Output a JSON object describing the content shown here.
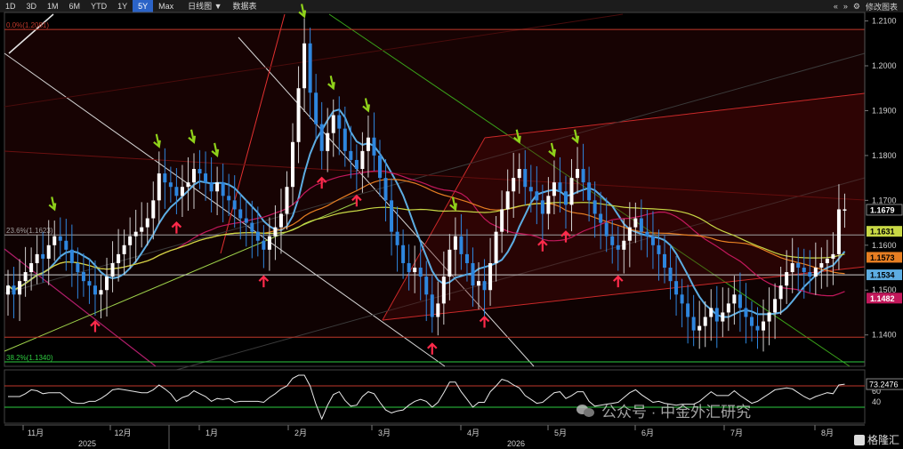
{
  "toolbar": {
    "ranges": [
      "1D",
      "3D",
      "1M",
      "6M",
      "YTD",
      "1Y",
      "5Y",
      "Max"
    ],
    "active_range": "5Y",
    "chart_type": "日线图 ▼",
    "data_table": "数据表",
    "edit_chart": "修改图表",
    "nav_prev": "«",
    "nav_next": "»",
    "settings_glyph": "⚙"
  },
  "watermark": "公众号 · 中金外汇研究",
  "brand": "格隆汇",
  "chart_data": {
    "type": "candlestick",
    "x_axis": {
      "month_labels": [
        "11月",
        "12月",
        "1月",
        "2月",
        "3月",
        "4月",
        "5月",
        "6月",
        "7月",
        "8月"
      ],
      "year_labels": [
        "2025",
        "2026"
      ]
    },
    "y_axis": {
      "ylim": [
        1.133,
        1.2115
      ],
      "ticks": [
        "1.2100",
        "1.2000",
        "1.1900",
        "1.1800",
        "1.1700",
        "1.1600",
        "1.1500",
        "1.1400"
      ]
    },
    "price_close": [
      1.151,
      1.149,
      1.152,
      1.154,
      1.156,
      1.158,
      1.157,
      1.16,
      1.162,
      1.161,
      1.159,
      1.156,
      1.154,
      1.152,
      1.151,
      1.149,
      1.15,
      1.153,
      1.156,
      1.158,
      1.16,
      1.162,
      1.163,
      1.164,
      1.166,
      1.17,
      1.176,
      1.174,
      1.173,
      1.171,
      1.173,
      1.174,
      1.177,
      1.176,
      1.174,
      1.172,
      1.174,
      1.171,
      1.17,
      1.168,
      1.166,
      1.165,
      1.163,
      1.161,
      1.159,
      1.162,
      1.164,
      1.167,
      1.173,
      1.183,
      1.195,
      1.205,
      1.194,
      1.187,
      1.181,
      1.185,
      1.189,
      1.186,
      1.181,
      1.179,
      1.177,
      1.181,
      1.184,
      1.18,
      1.175,
      1.17,
      1.163,
      1.16,
      1.156,
      1.154,
      1.155,
      1.153,
      1.149,
      1.144,
      1.147,
      1.153,
      1.159,
      1.162,
      1.158,
      1.156,
      1.151,
      1.152,
      1.15,
      1.156,
      1.163,
      1.168,
      1.172,
      1.175,
      1.177,
      1.173,
      1.172,
      1.17,
      1.167,
      1.171,
      1.174,
      1.172,
      1.169,
      1.175,
      1.177,
      1.174,
      1.17,
      1.167,
      1.165,
      1.162,
      1.16,
      1.159,
      1.161,
      1.164,
      1.166,
      1.163,
      1.162,
      1.16,
      1.158,
      1.155,
      1.152,
      1.149,
      1.147,
      1.144,
      1.141,
      1.142,
      1.144,
      1.146,
      1.143,
      1.145,
      1.147,
      1.149,
      1.146,
      1.144,
      1.142,
      1.141,
      1.143,
      1.145,
      1.148,
      1.151,
      1.154,
      1.156,
      1.155,
      1.154,
      1.153,
      1.155,
      1.156,
      1.157,
      1.158,
      1.168,
      1.168
    ],
    "overlay_lines": [
      {
        "label": "0.0%(1.2081)",
        "value": 1.2081,
        "color": "#c0392b"
      },
      {
        "label": "23.6%(1.1623)",
        "value": 1.1623,
        "color": "#a0a0a0"
      },
      {
        "label": "38.2%(1.1340)",
        "value": 1.134,
        "color": "#2ecc40"
      },
      {
        "value": 1.1395,
        "color": "#c0392b"
      },
      {
        "value": 1.1534,
        "color": "#cfcfcf"
      }
    ],
    "last_values": [
      {
        "label": "1.1679",
        "color": "#ffffff",
        "bg": "#000000"
      },
      {
        "label": "1.1631",
        "color": "#000000",
        "bg": "#c8d845"
      },
      {
        "label": "1.1573",
        "color": "#000000",
        "bg": "#e67e22"
      },
      {
        "label": "1.1534",
        "color": "#000000",
        "bg": "#5dade2"
      },
      {
        "label": "1.1482",
        "color": "#ffffff",
        "bg": "#c2185b"
      }
    ],
    "oscillator": {
      "ticks": [
        "60",
        "40"
      ],
      "last_value": "73.2476"
    },
    "green_arrow_count": 11,
    "red_arrow_count": 10
  }
}
